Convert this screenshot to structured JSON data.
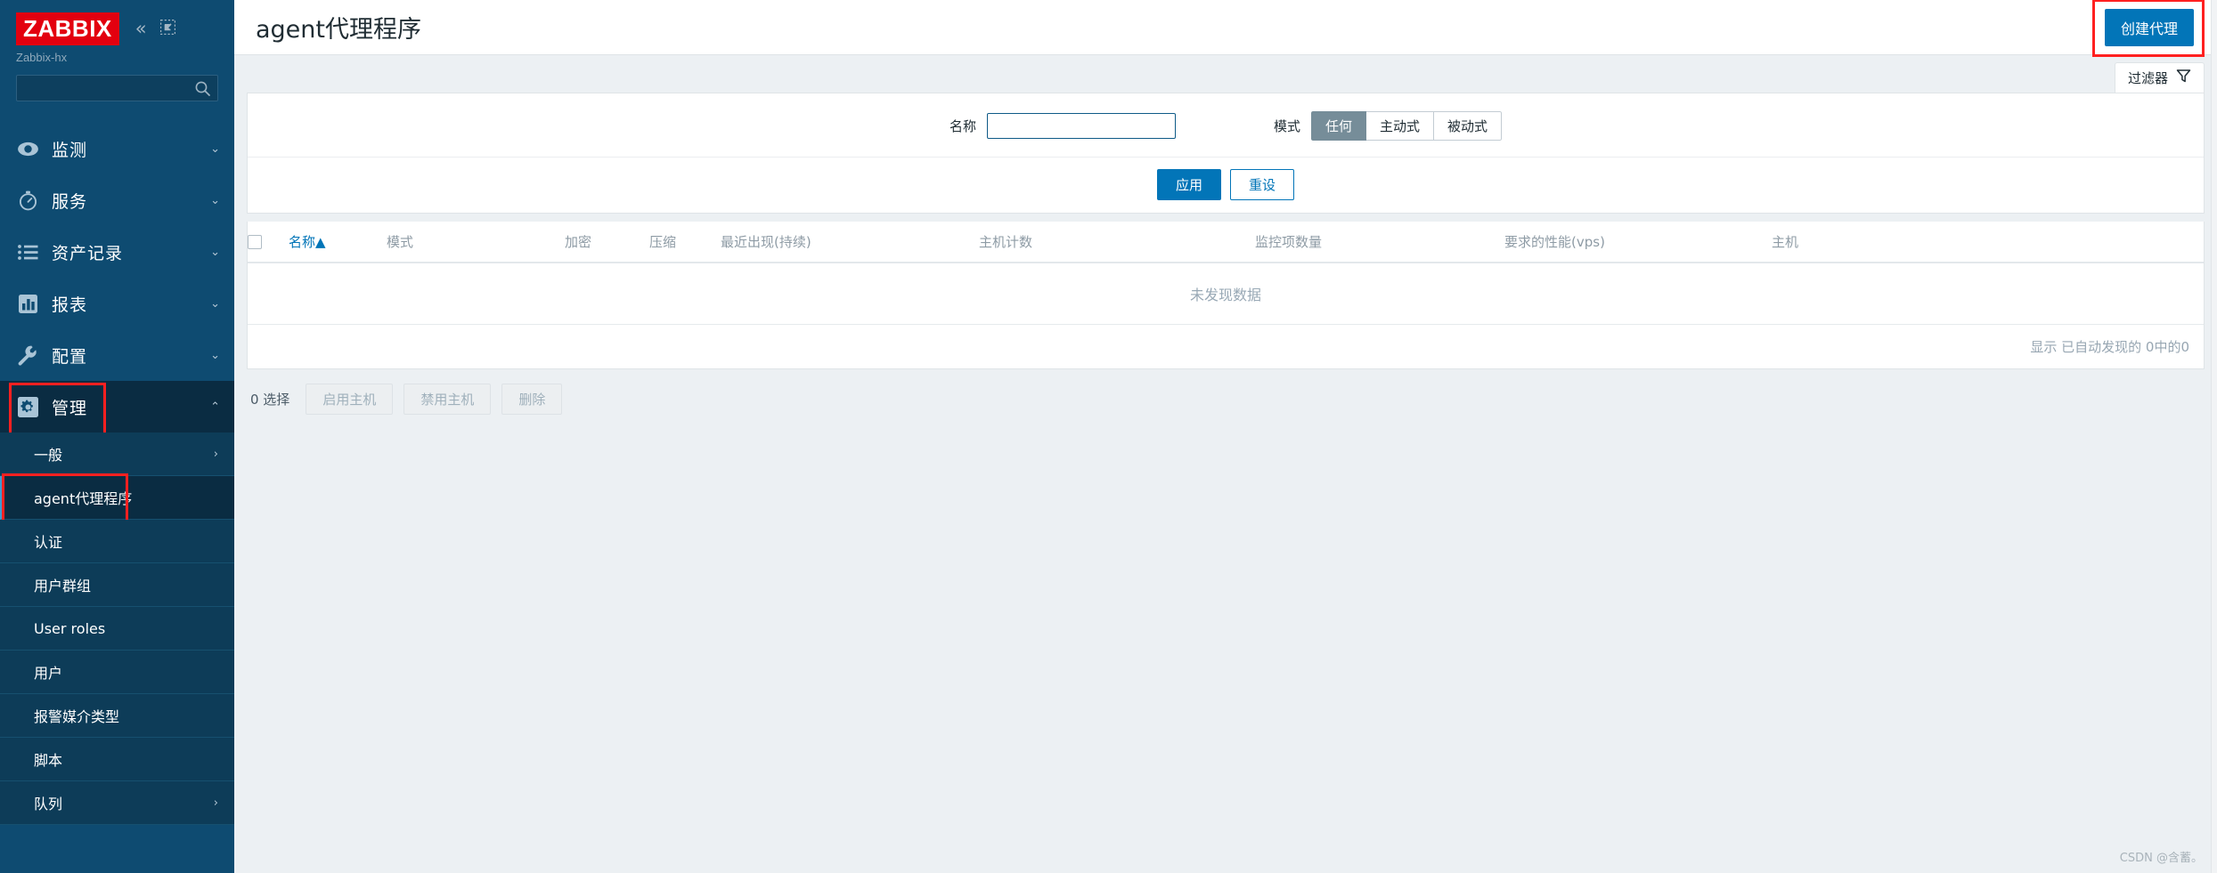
{
  "sidebar": {
    "logo_text": "ZABBIX",
    "server_name": "Zabbix-hx",
    "collapse_icon": "chevron-double-left-icon",
    "hide_icon": "collapse-panel-icon",
    "search": {
      "value": "",
      "placeholder": ""
    },
    "nav": [
      {
        "label": "监测",
        "icon": "eye-icon",
        "arrow": "⌄",
        "expanded": false,
        "highlight": false
      },
      {
        "label": "服务",
        "icon": "clock-icon",
        "arrow": "⌄",
        "expanded": false,
        "highlight": false
      },
      {
        "label": "资产记录",
        "icon": "list-icon",
        "arrow": "⌄",
        "expanded": false,
        "highlight": false
      },
      {
        "label": "报表",
        "icon": "bar-chart-icon",
        "arrow": "⌄",
        "expanded": false,
        "highlight": false
      },
      {
        "label": "配置",
        "icon": "wrench-icon",
        "arrow": "⌄",
        "expanded": false,
        "highlight": false
      },
      {
        "label": "管理",
        "icon": "gear-icon",
        "arrow": "⌃",
        "expanded": true,
        "highlight": true
      }
    ],
    "submenu": [
      {
        "label": "一般",
        "arrow": "›",
        "active": false,
        "highlight": false
      },
      {
        "label": "agent代理程序",
        "arrow": "",
        "active": true,
        "highlight": true
      },
      {
        "label": "认证",
        "arrow": "",
        "active": false,
        "highlight": false
      },
      {
        "label": "用户群组",
        "arrow": "",
        "active": false,
        "highlight": false
      },
      {
        "label": "User roles",
        "arrow": "",
        "active": false,
        "highlight": false
      },
      {
        "label": "用户",
        "arrow": "",
        "active": false,
        "highlight": false
      },
      {
        "label": "报警媒介类型",
        "arrow": "",
        "active": false,
        "highlight": false
      },
      {
        "label": "脚本",
        "arrow": "",
        "active": false,
        "highlight": false
      },
      {
        "label": "队列",
        "arrow": "›",
        "active": false,
        "highlight": false
      }
    ]
  },
  "header": {
    "title": "agent代理程序",
    "create_button": "创建代理"
  },
  "filter": {
    "tab_label": "过滤器",
    "tab_icon": "funnel-icon",
    "name_label": "名称",
    "name_value": "",
    "name_placeholder": "",
    "mode_label": "模式",
    "mode_options": [
      "任何",
      "主动式",
      "被动式"
    ],
    "mode_selected": "任何",
    "apply_label": "应用",
    "reset_label": "重设"
  },
  "table": {
    "select_all_icon": "checkbox-icon",
    "columns": [
      "名称",
      "模式",
      "加密",
      "压缩",
      "最近出现(持续)",
      "主机计数",
      "监控项数量",
      "要求的性能(vps)",
      "主机"
    ],
    "sort_column": "名称",
    "sort_indicator": "▲",
    "rows": [],
    "empty_message": "未发现数据",
    "footer_text": "显示 已自动发现的 0中的0"
  },
  "bulk": {
    "selected_text": "0 选择",
    "buttons": [
      "启用主机",
      "禁用主机",
      "删除"
    ]
  },
  "watermark": "CSDN @含蓄。",
  "colors": {
    "sidebar_bg": "#0e4b71",
    "sidebar_selected": "#0a2c42",
    "submenu_bg": "#0d3c58",
    "brand_red": "#e3000f",
    "accent_blue": "#0275b8",
    "highlight_red": "#ff2020",
    "radio_active": "#768d99",
    "page_bg": "#ecf0f3"
  }
}
